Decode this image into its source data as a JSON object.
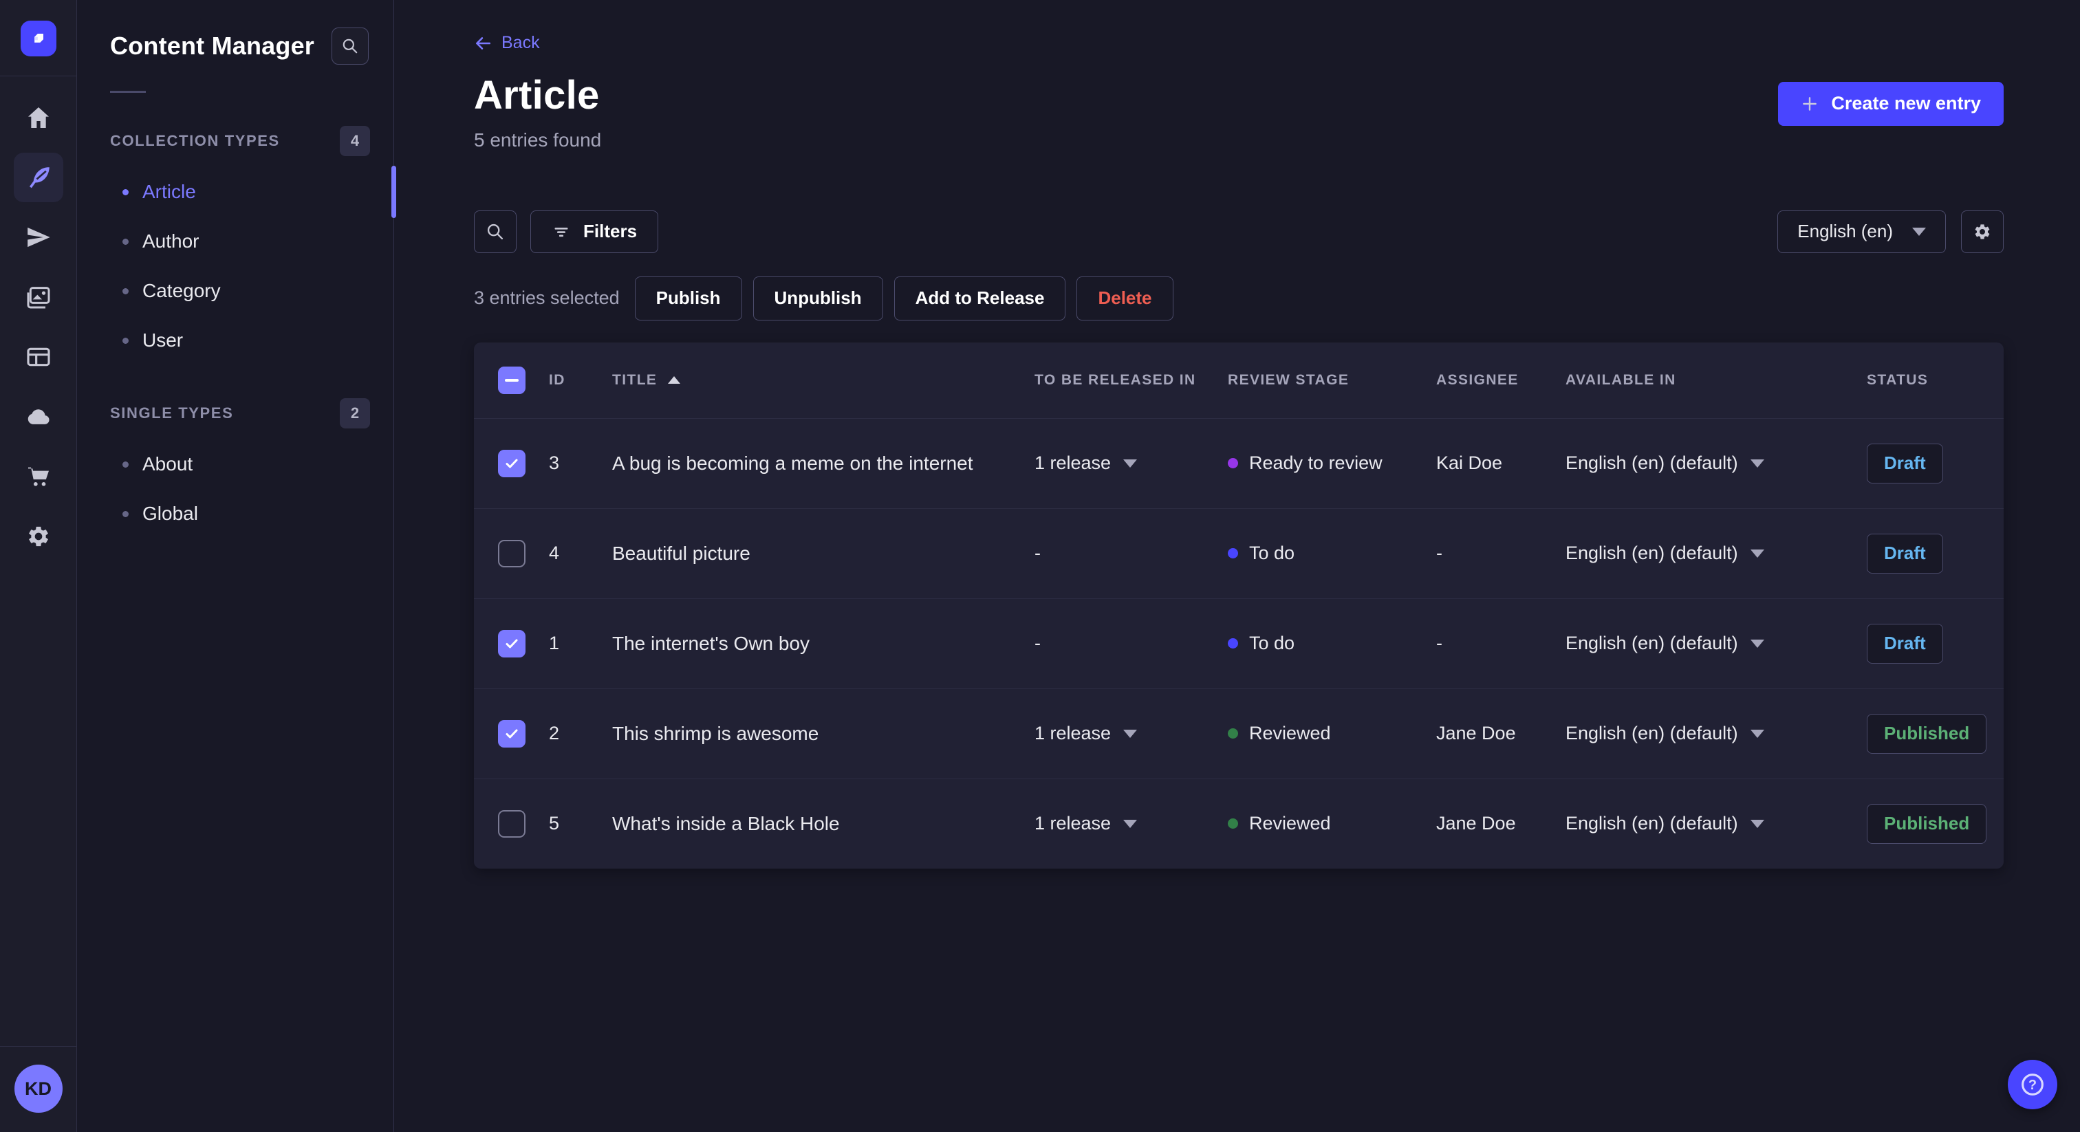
{
  "rail": {
    "logo_name": "strapi-logo",
    "avatar_initials": "KD"
  },
  "sidebar": {
    "title": "Content Manager",
    "sections": [
      {
        "label": "COLLECTION TYPES",
        "count": "4",
        "items": [
          {
            "label": "Article",
            "active": true
          },
          {
            "label": "Author"
          },
          {
            "label": "Category"
          },
          {
            "label": "User"
          }
        ]
      },
      {
        "label": "SINGLE TYPES",
        "count": "2",
        "items": [
          {
            "label": "About"
          },
          {
            "label": "Global"
          }
        ]
      }
    ]
  },
  "header": {
    "back_label": "Back",
    "title": "Article",
    "subtitle": "5 entries found",
    "create_button": "Create new entry"
  },
  "toolbar": {
    "filters_label": "Filters",
    "locale_value": "English (en)"
  },
  "selection": {
    "text": "3 entries selected",
    "publish": "Publish",
    "unpublish": "Unpublish",
    "add_to_release": "Add to Release",
    "delete": "Delete"
  },
  "table": {
    "headers": {
      "id": "ID",
      "title": "TITLE",
      "released": "TO BE RELEASED IN",
      "stage": "REVIEW STAGE",
      "assignee": "ASSIGNEE",
      "available": "AVAILABLE IN",
      "status": "STATUS"
    },
    "rows": [
      {
        "checked": true,
        "id": "3",
        "title": "A bug is becoming a meme on the internet",
        "released": "1 release",
        "released_caret": true,
        "stage": "Ready to review",
        "stage_color": "#9736e8",
        "assignee": "Kai Doe",
        "available": "English (en) (default)",
        "status": "Draft",
        "status_color": "#66b7f1"
      },
      {
        "checked": false,
        "id": "4",
        "title": "Beautiful picture",
        "released": "-",
        "released_caret": false,
        "stage": "To do",
        "stage_color": "#4945ff",
        "assignee": "-",
        "available": "English (en) (default)",
        "status": "Draft",
        "status_color": "#66b7f1"
      },
      {
        "checked": true,
        "id": "1",
        "title": "The internet's Own boy",
        "released": "-",
        "released_caret": false,
        "stage": "To do",
        "stage_color": "#4945ff",
        "assignee": "-",
        "available": "English (en) (default)",
        "status": "Draft",
        "status_color": "#66b7f1"
      },
      {
        "checked": true,
        "id": "2",
        "title": "This shrimp is awesome",
        "released": "1 release",
        "released_caret": true,
        "stage": "Reviewed",
        "stage_color": "#328048",
        "assignee": "Jane Doe",
        "available": "English (en) (default)",
        "status": "Published",
        "status_color": "#5cb176"
      },
      {
        "checked": false,
        "id": "5",
        "title": "What's inside a Black Hole",
        "released": "1 release",
        "released_caret": true,
        "stage": "Reviewed",
        "stage_color": "#328048",
        "assignee": "Jane Doe",
        "available": "English (en) (default)",
        "status": "Published",
        "status_color": "#5cb176"
      }
    ]
  },
  "colors": {
    "primary": "#4945ff",
    "primary_light": "#7b79ff",
    "page_bg": "#181826",
    "surface": "#212134",
    "border": "#4a4a6a",
    "muted_text": "#a5a5ba",
    "danger": "#ee5e52",
    "draft": "#66b7f1",
    "published": "#5cb176"
  }
}
